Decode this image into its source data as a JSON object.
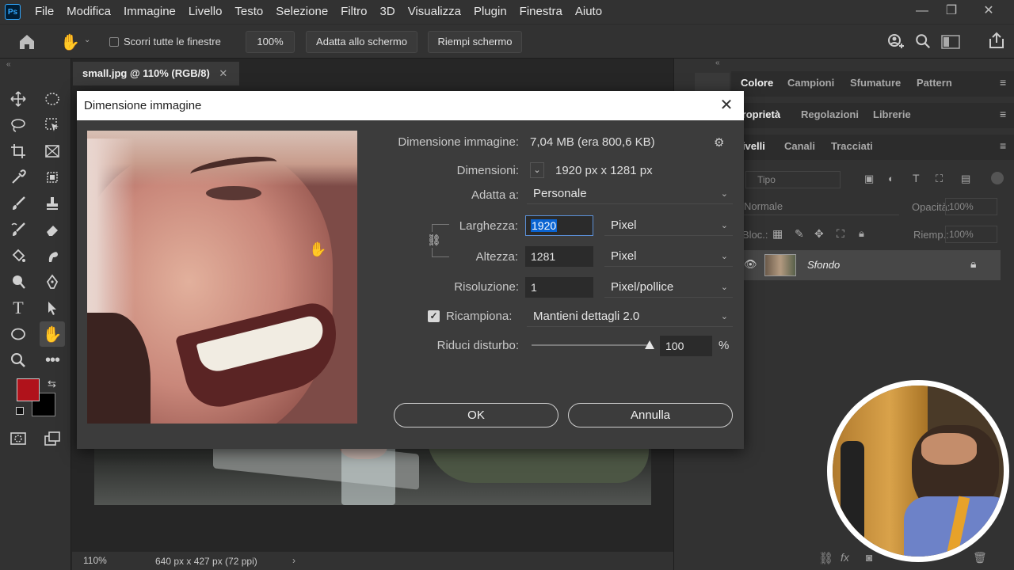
{
  "app": {
    "logo": "Ps"
  },
  "menu": [
    "File",
    "Modifica",
    "Immagine",
    "Livello",
    "Testo",
    "Selezione",
    "Filtro",
    "3D",
    "Visualizza",
    "Plugin",
    "Finestra",
    "Aiuto"
  ],
  "options": {
    "scroll_all": "Scorri tutte le finestre",
    "zoom": "100%",
    "fit_screen": "Adatta allo schermo",
    "fill_screen": "Riempi schermo"
  },
  "document": {
    "tab_title": "small.jpg @ 110% (RGB/8)",
    "zoom": "110%",
    "info": "640 px x 427 px (72 ppi)"
  },
  "panels": {
    "color_tabs": [
      "Colore",
      "Campioni",
      "Sfumature",
      "Pattern"
    ],
    "prop_tabs": [
      "Proprietà",
      "Regolazioni",
      "Librerie"
    ],
    "layer_tabs": [
      "Livelli",
      "Canali",
      "Tracciati"
    ],
    "filter_placeholder": "Tipo",
    "blend_mode": "Normale",
    "opacity_label": "Opacità:",
    "opacity_value": "100%",
    "lock_label": "Bloc.:",
    "fill_label": "Riemp.:",
    "fill_value": "100%",
    "layer_name": "Sfondo"
  },
  "dialog": {
    "title": "Dimensione immagine",
    "size_label": "Dimensione immagine:",
    "size_value": "7,04 MB (era 800,6 KB)",
    "dims_label": "Dimensioni:",
    "dims_value": "1920 px  x  1281 px",
    "fit_label": "Adatta a:",
    "fit_value": "Personale",
    "width_label": "Larghezza:",
    "width_value": "1920",
    "width_unit": "Pixel",
    "height_label": "Altezza:",
    "height_value": "1281",
    "height_unit": "Pixel",
    "res_label": "Risoluzione:",
    "res_value": "1",
    "res_unit": "Pixel/pollice",
    "resample_label": "Ricampiona:",
    "resample_checked": true,
    "resample_value": "Mantieni dettagli 2.0",
    "noise_label": "Riduci disturbo:",
    "noise_value": "100",
    "noise_unit": "%",
    "ok": "OK",
    "cancel": "Annulla"
  },
  "colors": {
    "foreground": "#b0121b",
    "background": "#000000",
    "highlight": "#0a64d2"
  }
}
